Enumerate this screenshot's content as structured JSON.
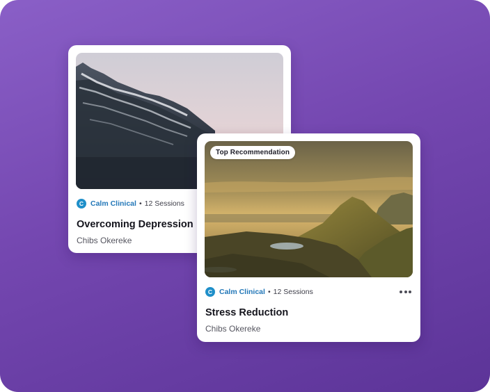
{
  "cards": [
    {
      "provider_initial": "C",
      "provider": "Calm Clinical",
      "separator": "•",
      "sessions": "12 Sessions",
      "title": "Overcoming Depression",
      "author": "Chibs Okereke",
      "image": "mountain-peak-dusk"
    },
    {
      "badge": "Top Recommendation",
      "provider_initial": "C",
      "provider": "Calm Clinical",
      "separator": "•",
      "sessions": "12 Sessions",
      "title": "Stress Reduction",
      "author": "Chibs Okereke",
      "image": "highland-valley-sunrise",
      "more_icon": "more-horizontal-icon"
    }
  ],
  "colors": {
    "background_top": "#8a5fc7",
    "background_bottom": "#5c3498",
    "provider_blue": "#2277b8",
    "logo_blue": "#1f8fc9"
  }
}
